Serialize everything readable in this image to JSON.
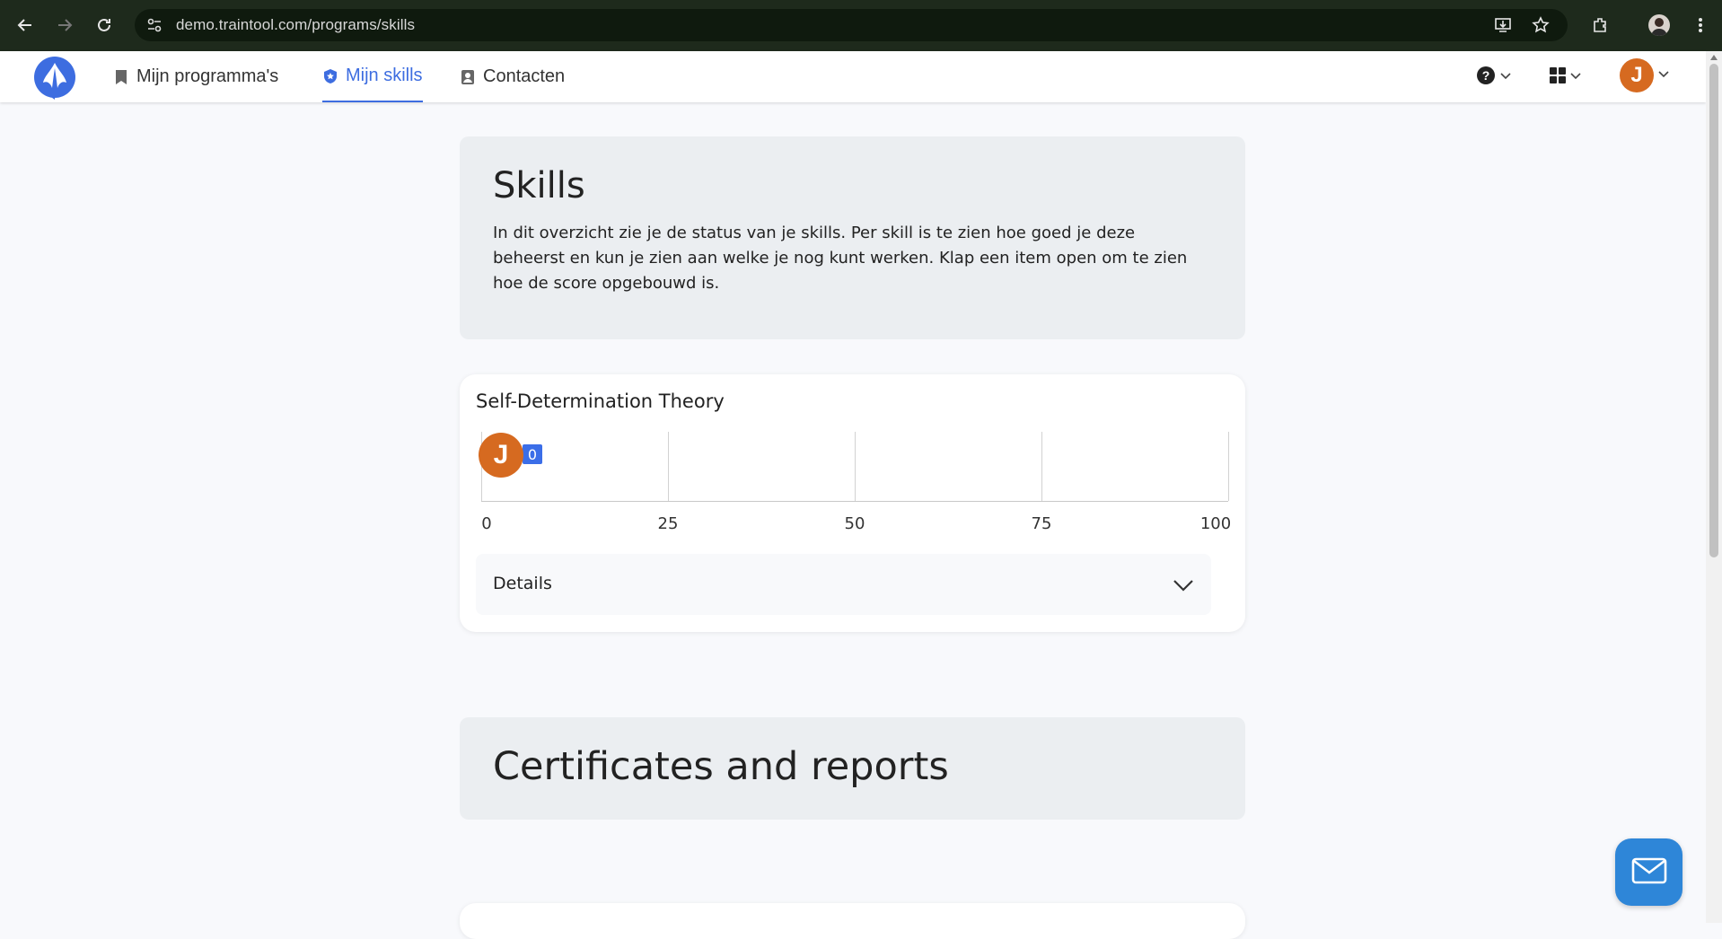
{
  "browser": {
    "url": "demo.traintool.com/programs/skills",
    "icons": [
      "back-icon",
      "forward-icon",
      "reload-icon",
      "site-info-icon",
      "install-icon",
      "star-icon",
      "extensions-icon",
      "profile-avatar",
      "menu-icon"
    ]
  },
  "header": {
    "nav": [
      {
        "label": "Mijn programma's",
        "icon": "bookmark-icon"
      },
      {
        "label": "Mijn skills",
        "icon": "shield-star-icon",
        "active": true
      },
      {
        "label": "Contacten",
        "icon": "contacts-icon"
      }
    ],
    "help_icon": "help-icon",
    "apps_icon": "apps-grid-icon",
    "user_initial": "J"
  },
  "intro": {
    "title": "Skills",
    "text": "In dit overzicht zie je de status van je skills. Per skill is te zien hoe goed je deze beheerst en kun je zien aan welke je nog kunt werken. Klap een item open om te zien hoe de score opgebouwd is."
  },
  "skill": {
    "title": "Self-Determination Theory",
    "user_initial": "J",
    "score": "0",
    "ticks": [
      "0",
      "25",
      "50",
      "75",
      "100"
    ],
    "details_label": "Details"
  },
  "certificates": {
    "title": "Certificates and reports"
  },
  "colors": {
    "accent": "#3d6de0",
    "avatar": "#d66a20",
    "fab": "#2e86d8"
  }
}
